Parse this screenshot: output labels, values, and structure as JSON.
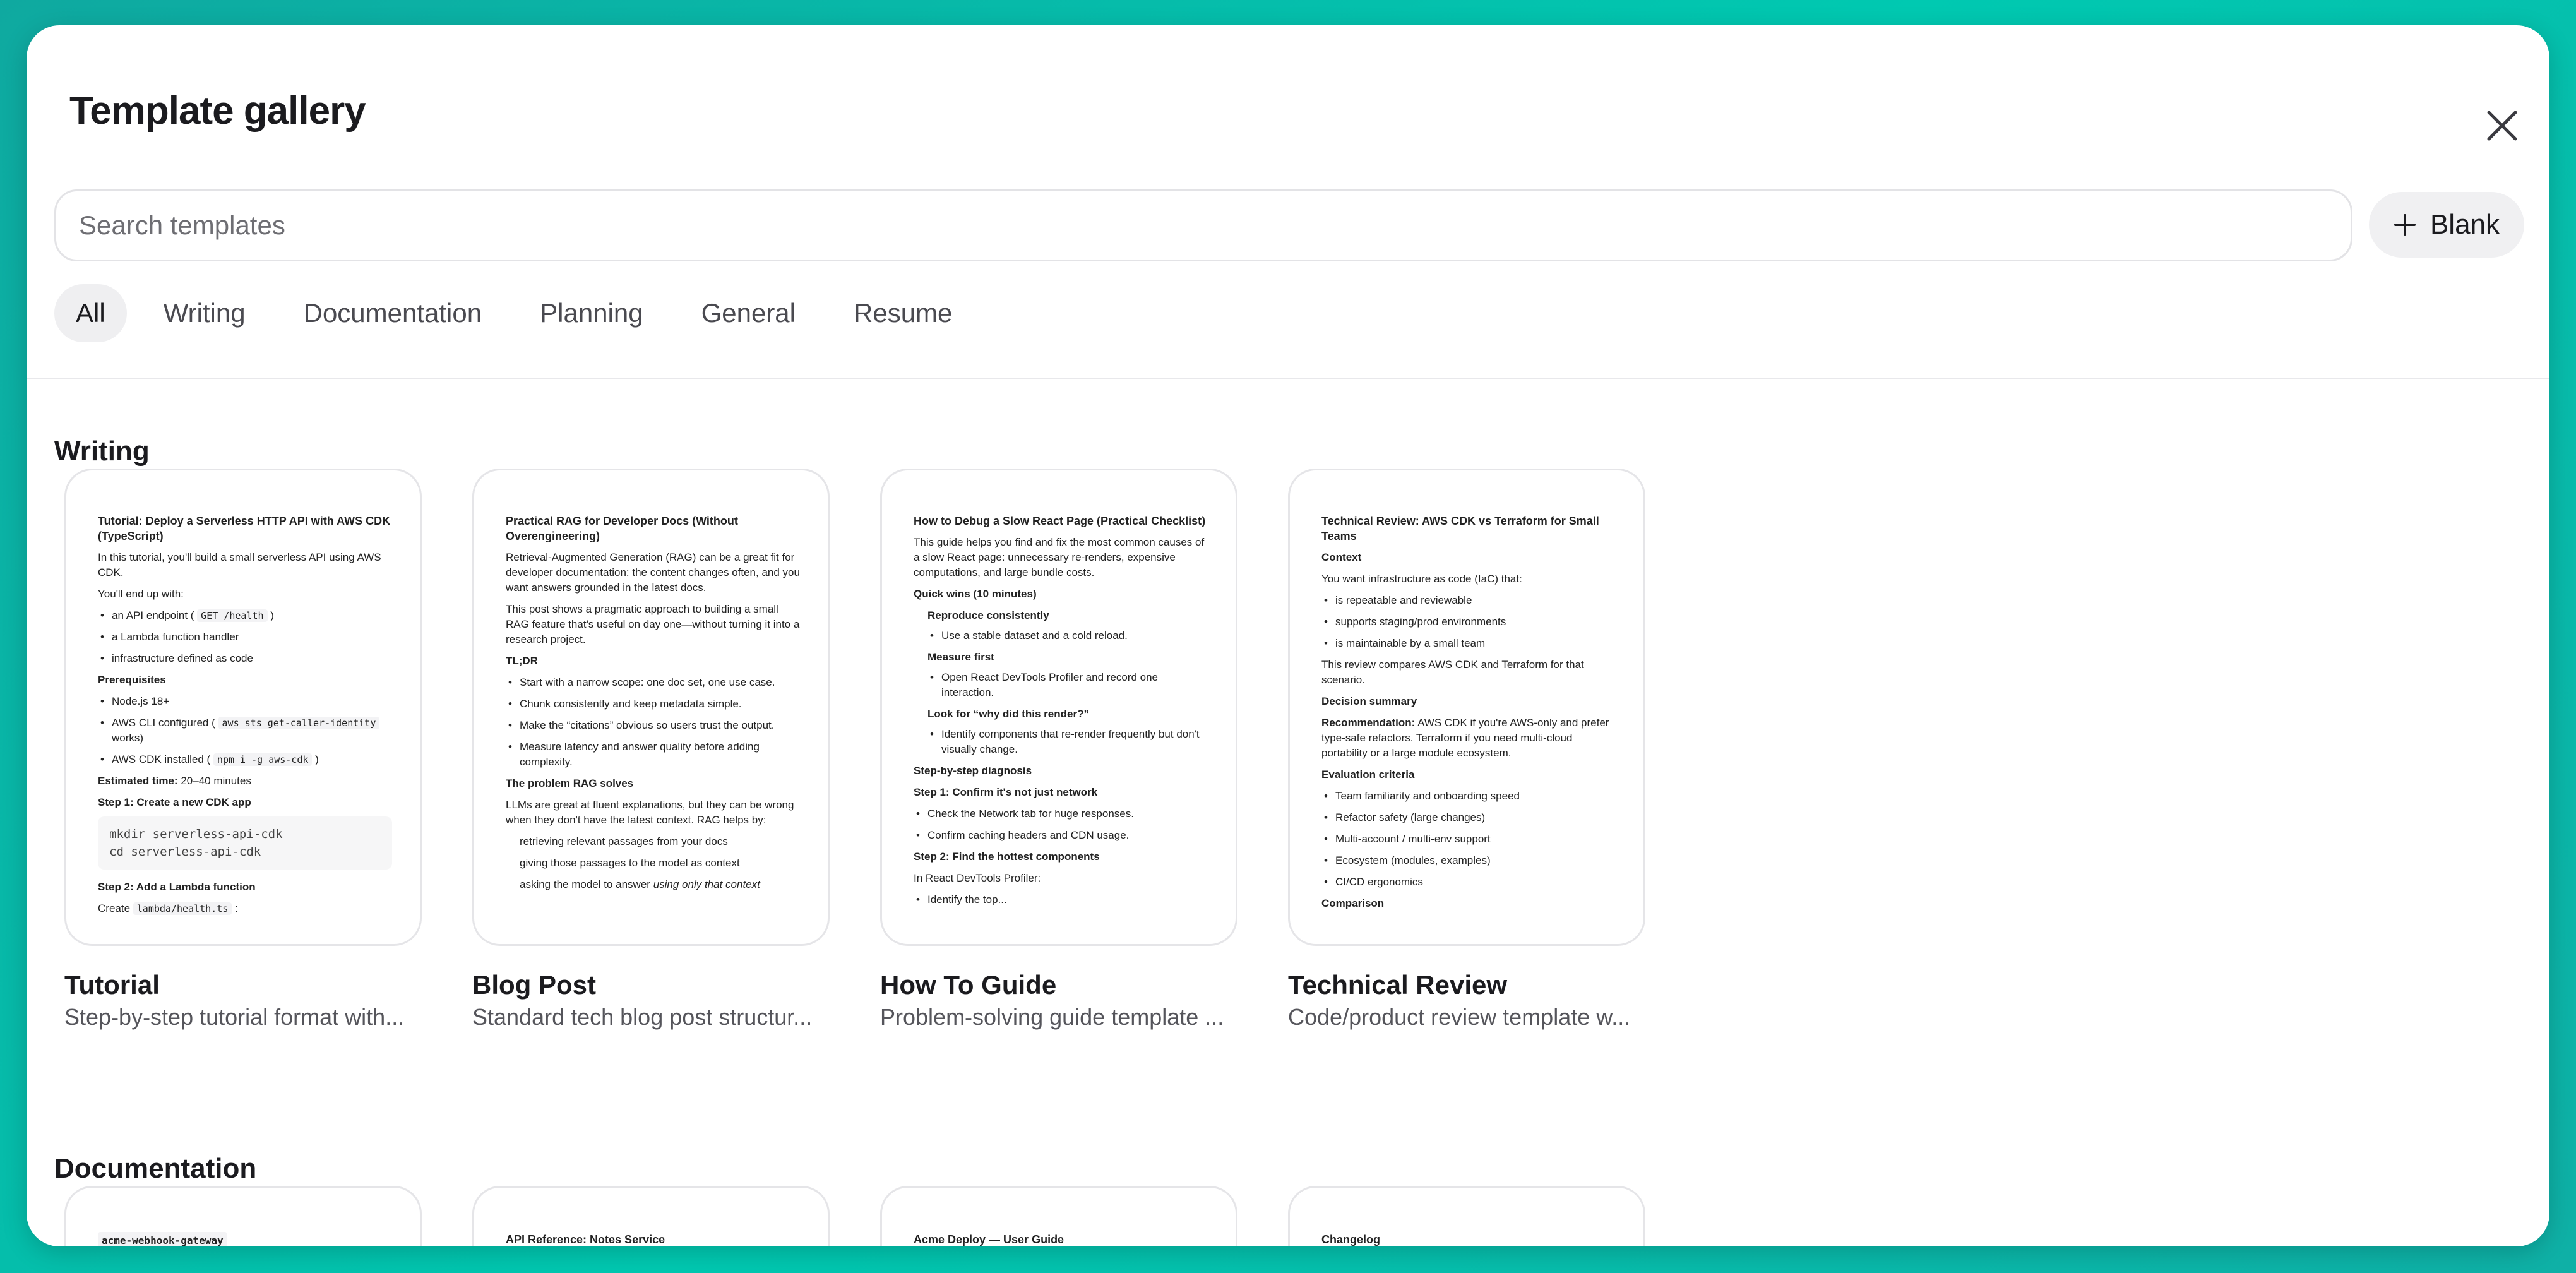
{
  "header": {
    "title": "Template gallery"
  },
  "search": {
    "placeholder": "Search templates"
  },
  "blank_button": {
    "label": "Blank"
  },
  "tabs": [
    {
      "label": "All",
      "active": true
    },
    {
      "label": "Writing"
    },
    {
      "label": "Documentation"
    },
    {
      "label": "Planning"
    },
    {
      "label": "General"
    },
    {
      "label": "Resume"
    }
  ],
  "sections": {
    "writing": {
      "title": "Writing",
      "cards": [
        {
          "name": "Tutorial",
          "description": "Step-by-step tutorial format with...",
          "preview": {
            "title": "Tutorial: Deploy a Serverless HTTP API with AWS CDK (TypeScript)",
            "intro": "In this tutorial, you'll build a small serverless API using AWS CDK.",
            "endup": "You'll end up with:",
            "endup_items": [
              "an API endpoint (",
              "GET /health",
              ")",
              "a Lambda function handler",
              "infrastructure defined as code"
            ],
            "prereq_heading": "Prerequisites",
            "prereq_node": "Node.js 18+",
            "prereq_cli_a": "AWS CLI configured (",
            "prereq_cli_code": "aws sts get-caller-identity",
            "prereq_cli_b": "works)",
            "prereq_cdk_a": "AWS CDK installed (",
            "prereq_cdk_code": "npm i -g aws-cdk",
            "prereq_cdk_b": ")",
            "time_label": "Estimated time:",
            "time_value": "20–40 minutes",
            "step1": "Step 1: Create a new CDK app",
            "code1": "mkdir serverless-api-cdk",
            "code2": "cd serverless-api-cdk",
            "step2": "Step 2: Add a Lambda function",
            "create_a": "Create",
            "create_code": "lambda/health.ts",
            "create_b": ":"
          }
        },
        {
          "name": "Blog Post",
          "description": "Standard tech blog post structur...",
          "preview": {
            "title": "Practical RAG for Developer Docs (Without Overengineering)",
            "p1": "Retrieval-Augmented Generation (RAG) can be a great fit for developer documentation: the content changes often, and you want answers grounded in the latest docs.",
            "p2": "This post shows a pragmatic approach to building a small RAG feature that's useful on day one—without turning it into a research project.",
            "tldr": "TL;DR",
            "tldr_items": [
              "Start with a narrow scope: one doc set, one use case.",
              "Chunk consistently and keep metadata simple.",
              "Make the “citations” obvious so users trust the output.",
              "Measure latency and answer quality before adding complexity."
            ],
            "problem": "The problem RAG solves",
            "p3": "LLMs are great at fluent explanations, but they can be wrong when they don't have the latest context. RAG helps by:",
            "rag_items": [
              "retrieving relevant passages from your docs",
              "giving those passages to the model as context"
            ],
            "rag_last_a": "asking the model to answer",
            "rag_last_b": "using only that context"
          }
        },
        {
          "name": "How To Guide",
          "description": "Problem-solving guide template ...",
          "preview": {
            "title": "How to Debug a Slow React Page (Practical Checklist)",
            "intro": "This guide helps you find and fix the most common causes of a slow React page: unnecessary re-renders, expensive computations, and large bundle costs.",
            "quick": "Quick wins (10 minutes)",
            "repro": "Reproduce consistently",
            "repro_item": "Use a stable dataset and a cold reload.",
            "measure": "Measure first",
            "measure_item": "Open React DevTools Profiler and record one interaction.",
            "look": "Look for “why did this render?”",
            "look_item": "Identify components that re-render frequently but don't visually change.",
            "diag": "Step-by-step diagnosis",
            "s1": "Step 1: Confirm it's not just network",
            "s1_items": [
              "Check the Network tab for huge responses.",
              "Confirm caching headers and CDN usage."
            ],
            "s2": "Step 2: Find the hottest components",
            "s2_text": "In React DevTools Profiler:",
            "s2_item": "Identify the top..."
          }
        },
        {
          "name": "Technical Review",
          "description": "Code/product review template w...",
          "preview": {
            "title": "Technical Review: AWS CDK vs Terraform for Small Teams",
            "context": "Context",
            "context_text": "You want infrastructure as code (IaC) that:",
            "context_items": [
              "is repeatable and reviewable",
              "supports staging/prod environments",
              "is maintainable by a small team"
            ],
            "compare_text": "This review compares AWS CDK and Terraform for that scenario.",
            "decision": "Decision summary",
            "rec_label": "Recommendation:",
            "rec_text": "AWS CDK if you're AWS-only and prefer type-safe refactors. Terraform if you need multi-cloud portability or a large module ecosystem.",
            "criteria": "Evaluation criteria",
            "criteria_items": [
              "Team familiarity and onboarding speed",
              "Refactor safety (large changes)",
              "Multi-account / multi-env support",
              "Ecosystem (modules, examples)",
              "CI/CD ergonomics"
            ],
            "comparison": "Comparison"
          }
        }
      ]
    },
    "documentation": {
      "title": "Documentation",
      "cards": [
        {
          "preview_title": "acme-webhook-gateway"
        },
        {
          "preview_title": "API Reference: Notes Service"
        },
        {
          "preview_title": "Acme Deploy — User Guide"
        },
        {
          "preview_title": "Changelog"
        }
      ]
    }
  },
  "icons": {
    "close": "close-icon",
    "plus": "plus-icon"
  }
}
